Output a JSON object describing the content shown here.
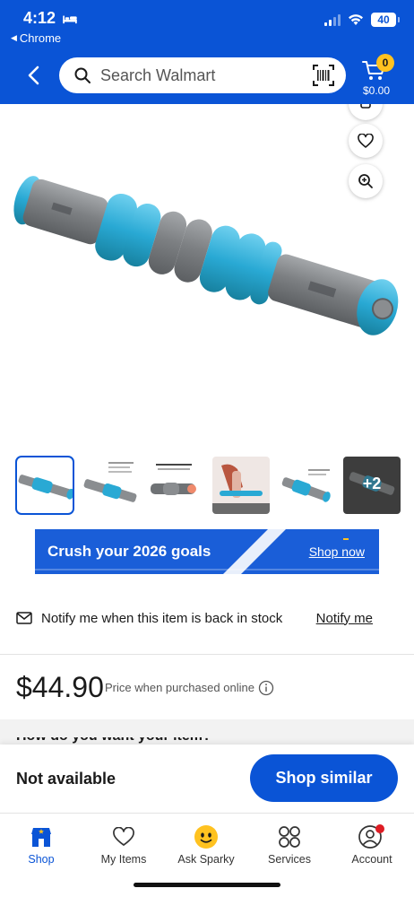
{
  "status_bar": {
    "time": "4:12",
    "battery": "40",
    "back_app": "Chrome"
  },
  "header": {
    "search_placeholder": "Search Walmart",
    "cart_count": "0",
    "cart_total": "$0.00",
    "background_color": "#0a54d6"
  },
  "product": {
    "thumbnails_more": "+2"
  },
  "banner": {
    "text": "Crush your 2026 goals",
    "link": "Shop now"
  },
  "notify": {
    "text": "Notify me when this item is back in stock",
    "link": "Notify me"
  },
  "price": {
    "amount": "$44.90",
    "note": "Price when purchased online"
  },
  "section_peek": "How do you want your item?",
  "action_bar": {
    "status": "Not available",
    "button": "Shop similar"
  },
  "tabs": [
    {
      "label": "Shop",
      "icon": "shop-icon",
      "active": true
    },
    {
      "label": "My Items",
      "icon": "heart-icon",
      "active": false
    },
    {
      "label": "Ask Sparky",
      "icon": "sparky-icon",
      "active": false
    },
    {
      "label": "Services",
      "icon": "services-icon",
      "active": false
    },
    {
      "label": "Account",
      "icon": "account-icon",
      "active": false
    }
  ],
  "colors": {
    "walmart_blue": "#0a54d6",
    "spark_yellow": "#ffc220",
    "roller_teal": "#29a9d4",
    "roller_grey": "#8a8d90"
  }
}
